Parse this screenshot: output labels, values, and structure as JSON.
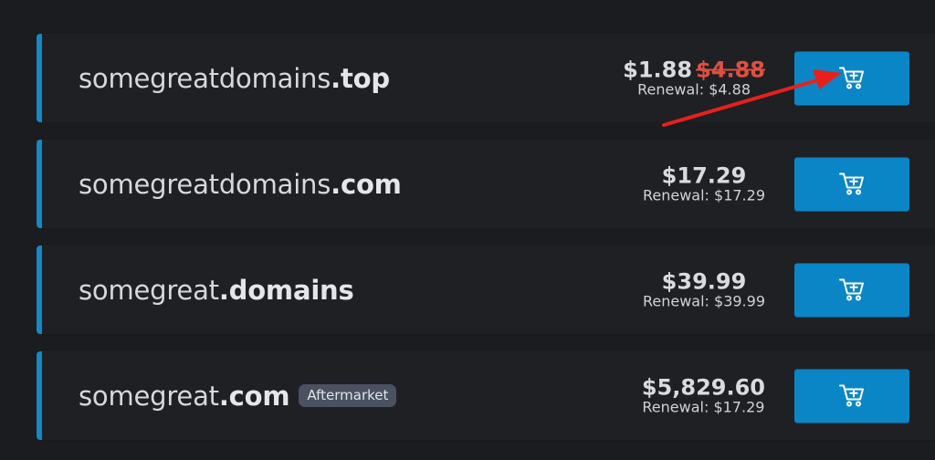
{
  "results": [
    {
      "name": "somegreatdomains",
      "tld": ".top",
      "price": "$1.88",
      "old_price": "$4.88",
      "renewal": "Renewal: $4.88",
      "badge": ""
    },
    {
      "name": "somegreatdomains",
      "tld": ".com",
      "price": "$17.29",
      "old_price": "",
      "renewal": "Renewal: $17.29",
      "badge": ""
    },
    {
      "name": "somegreat",
      "tld": ".domains",
      "price": "$39.99",
      "old_price": "",
      "renewal": "Renewal: $39.99",
      "badge": ""
    },
    {
      "name": "somegreat",
      "tld": ".com",
      "price": "$5,829.60",
      "old_price": "",
      "renewal": "Renewal: $17.29",
      "badge": "Aftermarket"
    }
  ],
  "icons": {
    "cart": "add-to-cart-icon",
    "annotation": "red-arrow"
  },
  "colors": {
    "accent": "#0a86c7",
    "row_border": "#1489c4",
    "strike_price": "#e0503f",
    "arrow": "#e8201c",
    "badge_bg": "#4a5160"
  }
}
